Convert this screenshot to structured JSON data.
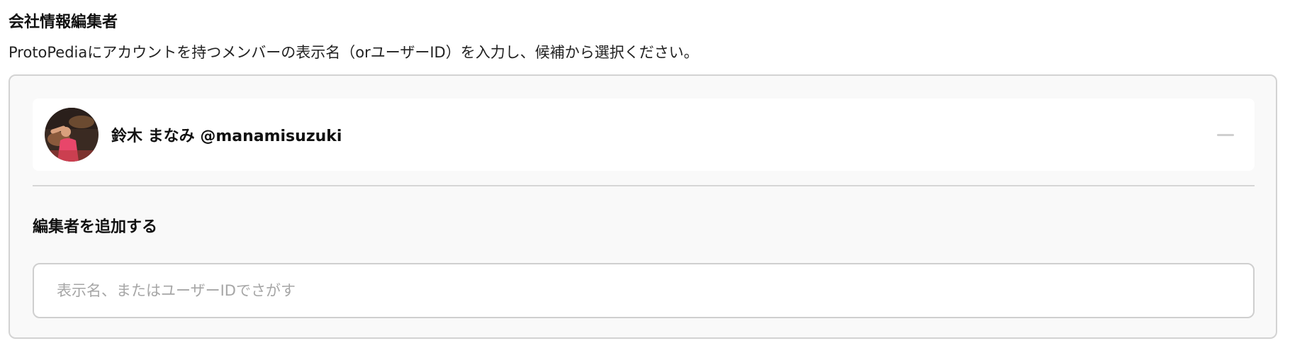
{
  "section": {
    "title": "会社情報編集者",
    "description": "ProtoPediaにアカウントを持つメンバーの表示名（orユーザーID）を入力し、候補から選択ください。"
  },
  "editors": [
    {
      "name": "鈴木 まなみ @manamisuzuki",
      "avatar": "avatar-photo",
      "remove_icon": "minus-icon"
    }
  ],
  "add_editor": {
    "heading": "編集者を追加する",
    "search_value": "",
    "search_placeholder": "表示名、またはユーザーIDでさがす"
  },
  "colors": {
    "panel_background": "#f9f9f9",
    "panel_border": "#d3d3d3",
    "placeholder_text": "#a6a6a6",
    "remove_icon": "#cfcfcf"
  }
}
